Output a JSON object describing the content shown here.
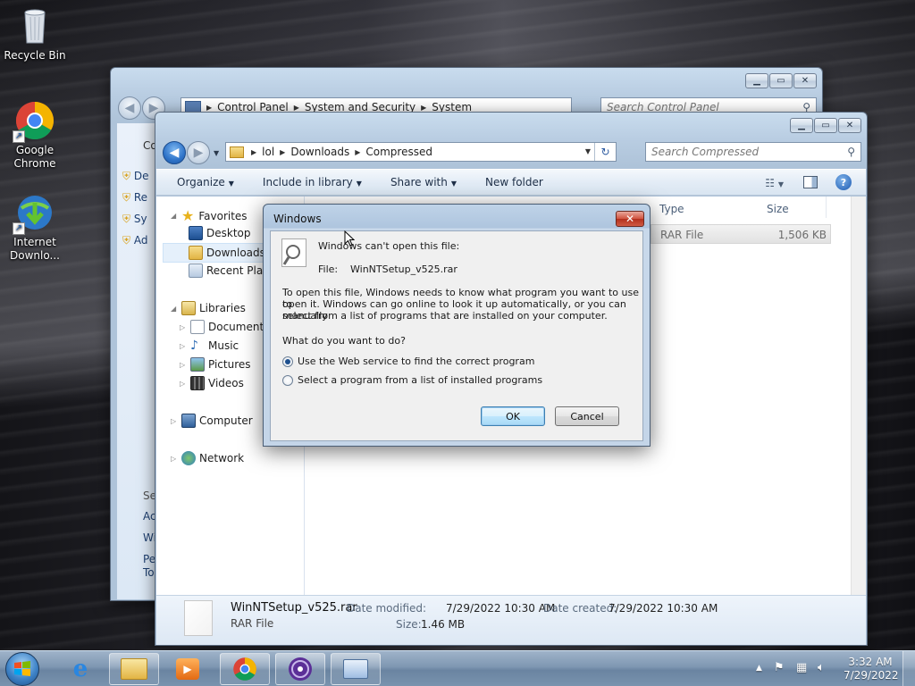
{
  "desktop": {
    "icons": [
      {
        "label": "Recycle Bin"
      },
      {
        "label": "Google Chrome"
      },
      {
        "label": "Internet Downlo..."
      }
    ]
  },
  "back_window": {
    "breadcrumb": [
      "Control Panel",
      "System and Security",
      "System"
    ],
    "search_placeholder": "Search Control Panel",
    "side_partial": [
      "Co",
      "De",
      "Re",
      "Sy",
      "Ad",
      "Se",
      "Ac",
      "Wi",
      "Pe",
      "To"
    ]
  },
  "explorer": {
    "breadcrumb": [
      "lol",
      "Downloads",
      "Compressed"
    ],
    "search_placeholder": "Search Compressed",
    "toolbar": {
      "organize": "Organize",
      "include_in_library": "Include in library",
      "share_with": "Share with",
      "new_folder": "New folder"
    },
    "tree": {
      "favorites": "Favorites",
      "desktop": "Desktop",
      "downloads": "Downloads",
      "recent_places": "Recent Places",
      "libraries": "Libraries",
      "documents": "Documents",
      "music": "Music",
      "pictures": "Pictures",
      "videos": "Videos",
      "computer": "Computer",
      "network": "Network"
    },
    "columns": {
      "type": "Type",
      "size": "Size"
    },
    "file_row": {
      "type": "RAR File",
      "size": "1,506 KB"
    },
    "details": {
      "filename": "WinNTSetup_v525.rar",
      "filetype": "RAR File",
      "modified_label": "Date modified:",
      "modified_value": "7/29/2022 10:30 AM",
      "size_label": "Size:",
      "size_value": "1.46 MB",
      "created_label": "Date created:",
      "created_value": "7/29/2022 10:30 AM"
    }
  },
  "dialog": {
    "title": "Windows",
    "heading": "Windows can't open this file:",
    "file_label": "File:",
    "file_name": "WinNTSetup_v525.rar",
    "line1": "To open this file, Windows needs to know what program you want to use to",
    "line2": "open it. Windows can go online to look it up automatically, or you can manually",
    "line3": "select from a list of programs that are installed on your computer.",
    "question": "What do you want to do?",
    "option_web": "Use the Web service to find the correct program",
    "option_list": "Select a program from a list of installed programs",
    "selected_option": "web",
    "ok": "OK",
    "cancel": "Cancel"
  },
  "taskbar": {
    "time": "3:32 AM",
    "date": "7/29/2022"
  },
  "colors": {
    "accent": "#2f74c9",
    "dialog_close": "#c4412b"
  }
}
